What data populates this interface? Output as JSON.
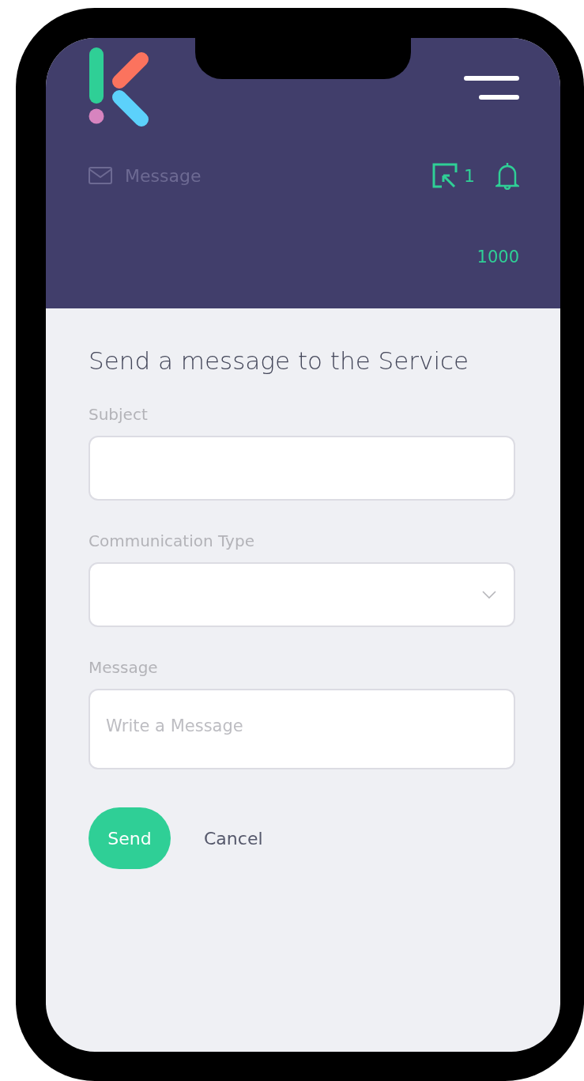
{
  "header": {
    "section_label": "Message",
    "task_count": "1",
    "balance": "1000"
  },
  "form": {
    "title": "Send a message to the Service",
    "fields": [
      {
        "kind": "text",
        "label": "Subject"
      },
      {
        "kind": "select",
        "label": "Communication Type"
      },
      {
        "kind": "textarea",
        "label": "Message",
        "placeholder": "Write a Message"
      }
    ],
    "actions": [
      {
        "kind": "primary",
        "label": "Send"
      },
      {
        "kind": "link",
        "label": "Cancel"
      }
    ]
  }
}
